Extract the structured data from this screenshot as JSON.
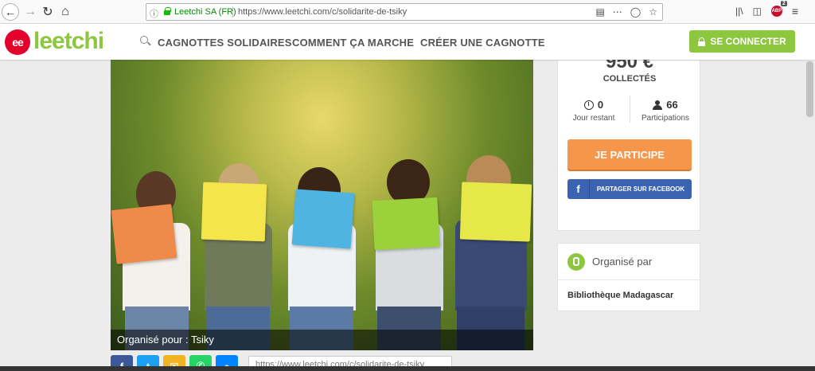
{
  "browser": {
    "site_identity": "Leetchi SA (FR)",
    "url": "https://www.leetchi.com/c/solidarite-de-tsiky",
    "abp_badge": "2",
    "icons": [
      "back-icon",
      "forward-icon",
      "reload-icon",
      "home-icon",
      "reader-icon",
      "more-icon",
      "pocket-icon",
      "bookmark-star-icon",
      "library-icon",
      "sidebar-icon",
      "adblock-icon",
      "menu-icon"
    ]
  },
  "header": {
    "logo_mark": "ee",
    "logo_text": "leetchi",
    "nav": [
      "CAGNOTTES SOLIDAIRES",
      "COMMENT ÇA MARCHE",
      "CRÉER UNE CAGNOTTE"
    ],
    "connect_label": "SE CONNECTER",
    "colors": {
      "brand_green": "#8dc63f",
      "brand_red": "#e4002b",
      "orange": "#f5964a",
      "facebook": "#3b63b2"
    }
  },
  "hero": {
    "caption": "Organisé pour : Tsiky"
  },
  "share": {
    "buttons": [
      "facebook",
      "twitter",
      "email",
      "whatsapp",
      "messenger"
    ],
    "url_text": "https://www.leetchi.com/c/solidarite-de-tsiky"
  },
  "summary": {
    "amount": "950 €",
    "collected_label": "COLLECTÉS",
    "days_value": "0",
    "days_label": "Jour restant",
    "participants_value": "66",
    "participants_label": "Participations",
    "participate_label": "JE PARTICIPE",
    "facebook_share_label": "PARTAGER SUR FACEBOOK"
  },
  "organizer": {
    "title": "Organisé par",
    "name": "Bibliothèque Madagascar"
  }
}
